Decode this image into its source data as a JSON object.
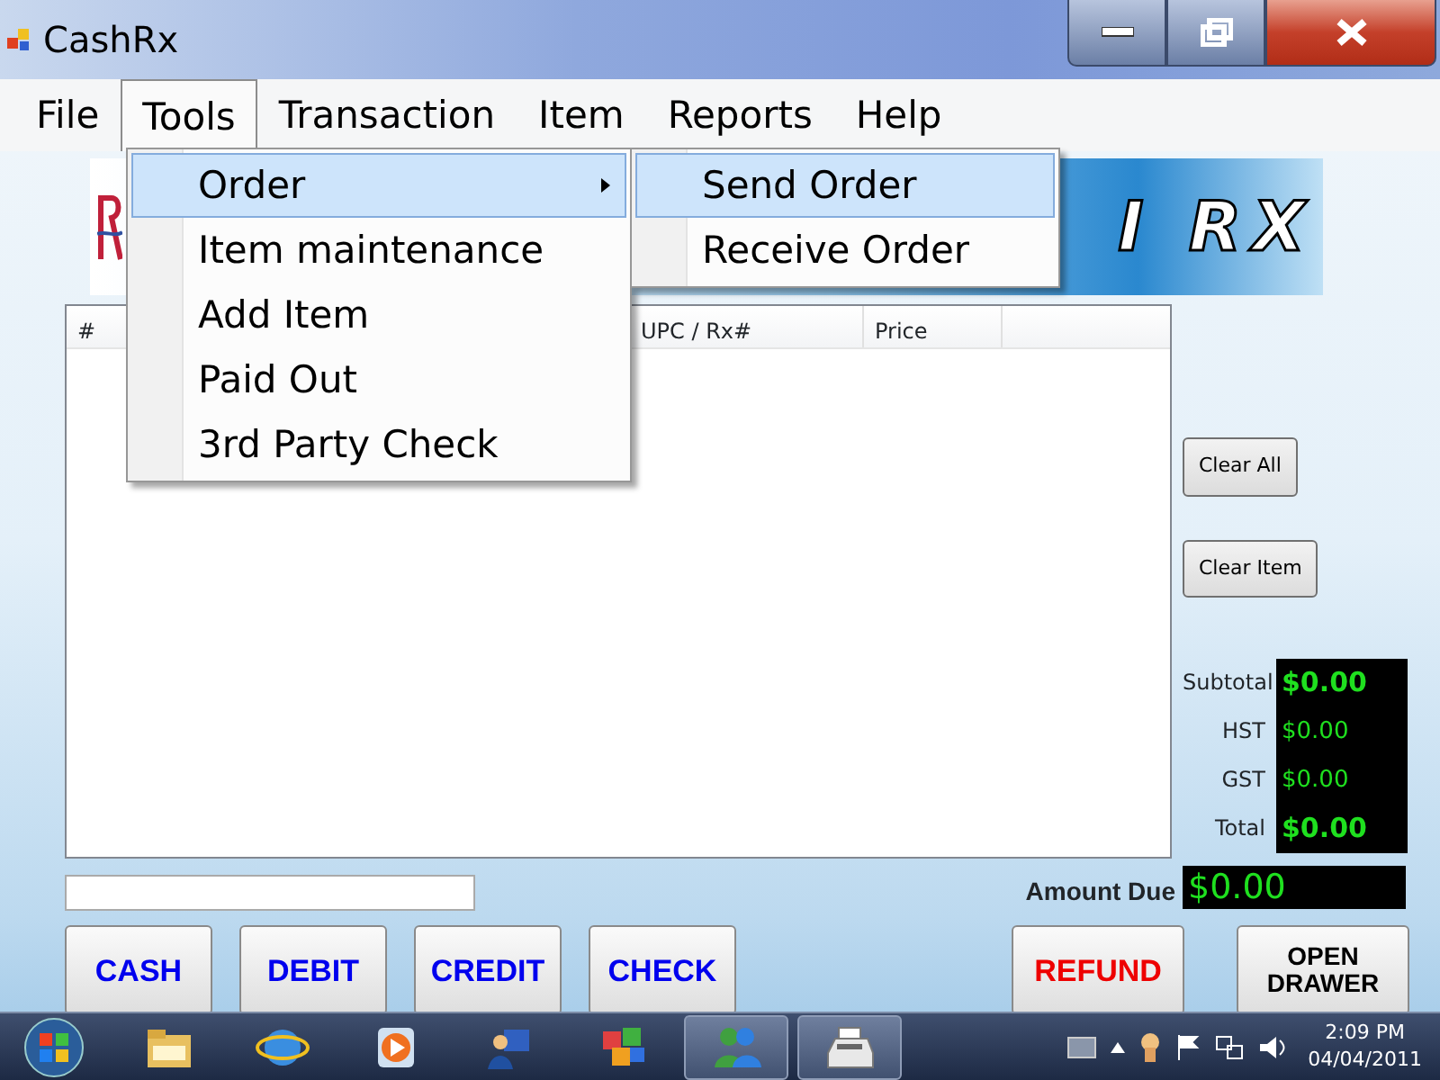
{
  "window": {
    "title": "CashRx"
  },
  "menu_bar": [
    {
      "label": "File",
      "selected": false
    },
    {
      "label": "Tools",
      "selected": true
    },
    {
      "label": "Transaction",
      "selected": false
    },
    {
      "label": "Item",
      "selected": false
    },
    {
      "label": "Reports",
      "selected": false
    },
    {
      "label": "Help",
      "selected": false
    }
  ],
  "tools_menu": [
    {
      "label": "Order",
      "selected": true,
      "submenu": true
    },
    {
      "label": "Item maintenance",
      "selected": false,
      "submenu": false
    },
    {
      "label": "Add Item",
      "selected": false,
      "submenu": false
    },
    {
      "label": "Paid Out",
      "selected": false,
      "submenu": false
    },
    {
      "label": "3rd Party Check",
      "selected": false,
      "submenu": false
    }
  ],
  "order_submenu": [
    {
      "label": "Send Order",
      "selected": true
    },
    {
      "label": "Receive Order",
      "selected": false
    }
  ],
  "banner": {
    "text": "I RX"
  },
  "table": {
    "columns": [
      "#",
      "UPC / Rx#",
      "Price"
    ]
  },
  "side_buttons": [
    "Clear All",
    "Clear Item"
  ],
  "totals": [
    {
      "label": "Subtotal",
      "value": "$0.00",
      "emphasis": true
    },
    {
      "label": "HST",
      "value": "$0.00",
      "emphasis": false
    },
    {
      "label": "GST",
      "value": "$0.00",
      "emphasis": false
    },
    {
      "label": "Total",
      "value": "$0.00",
      "emphasis": true
    }
  ],
  "amount_due": {
    "label": "Amount Due",
    "value": "$0.00"
  },
  "payment_buttons": [
    {
      "label": "CASH",
      "color": "#0000ee"
    },
    {
      "label": "DEBIT",
      "color": "#0000ee"
    },
    {
      "label": "CREDIT",
      "color": "#0000ee"
    },
    {
      "label": "CHECK",
      "color": "#0000ee"
    }
  ],
  "action_buttons": [
    {
      "label": "REFUND",
      "color": "#ee0000"
    },
    {
      "label": "OPEN DRAWER",
      "color": "#000000"
    }
  ],
  "taskbar": {
    "apps": [
      {
        "kind": "folder",
        "open": false
      },
      {
        "kind": "browser",
        "open": false
      },
      {
        "kind": "media",
        "open": false
      },
      {
        "kind": "network",
        "open": false
      },
      {
        "kind": "cubes",
        "open": false
      },
      {
        "kind": "messenger",
        "open": true
      },
      {
        "kind": "register",
        "open": true
      }
    ],
    "time": "2:09 PM",
    "date": "04/04/2011"
  }
}
